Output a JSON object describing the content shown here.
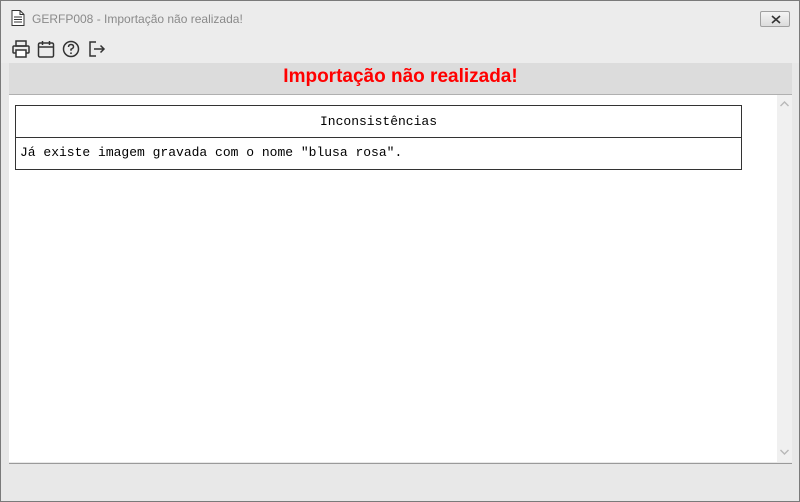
{
  "window": {
    "title": "GERFP008 - Importação não realizada!",
    "close_icon": "close-icon"
  },
  "toolbar": {
    "buttons": [
      {
        "icon": "printer-icon",
        "label": "Imprimir"
      },
      {
        "icon": "calendar-icon",
        "label": "Calendário"
      },
      {
        "icon": "help-icon",
        "label": "Ajuda"
      },
      {
        "icon": "exit-icon",
        "label": "Sair"
      }
    ]
  },
  "header": {
    "title": "Importação não realizada!",
    "title_color": "#ff0000"
  },
  "table": {
    "column_header": "Inconsistências",
    "rows": [
      "Já existe imagem gravada com o nome \"blusa rosa\"."
    ]
  }
}
